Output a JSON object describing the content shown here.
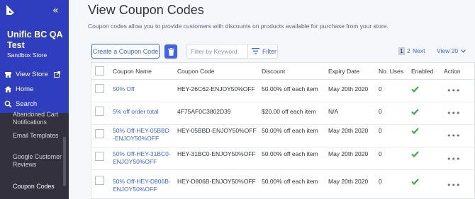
{
  "sidebar": {
    "store_name": "Unific BC QA Test",
    "store_type": "Sandbox Store",
    "collapse_icon": "«",
    "nav": [
      {
        "label": "View Store",
        "icon": "storefront-icon"
      },
      {
        "label": "Home",
        "icon": "home-icon"
      },
      {
        "label": "Search",
        "icon": "search-icon"
      }
    ],
    "items": [
      {
        "label": "Abandoned Cart Notifications"
      },
      {
        "label": "Email Templates"
      },
      {
        "label": "Google Customer Reviews"
      },
      {
        "label": "Coupon Codes"
      }
    ]
  },
  "page": {
    "title": "View Coupon Codes",
    "description": "Coupon codes allow you to provide customers with discounts on products available for purchase from your store."
  },
  "toolbar": {
    "create_label": "Create a Coupon Code",
    "filter_placeholder": "Filter by Keyword",
    "filter_label": "Filter",
    "pagination": {
      "current": "1",
      "page2": "2",
      "next": "Next"
    },
    "view_label": "View 20"
  },
  "table": {
    "headers": [
      "Coupon Name",
      "Coupon Code",
      "Discount",
      "Expiry Date",
      "No. Uses",
      "Enabled",
      "Action"
    ],
    "rows": [
      {
        "name": "50% Off",
        "code": "HEY-26C62-ENJOY50%OFF",
        "discount": "50.00% off each item",
        "expiry": "May 20th 2020",
        "uses": "0"
      },
      {
        "name": "5% off order total",
        "code": "4F75AF0C3802D39",
        "discount": "$20.00 off each item",
        "expiry": "N/A",
        "uses": "0"
      },
      {
        "name": "50% Off-HEY-05BBD-ENJOY50%OFF",
        "code": "HEY-05BBD-ENJOY50%OFF",
        "discount": "50.00% off each item",
        "expiry": "May 20th 2020",
        "uses": "0"
      },
      {
        "name": "50% Off-HEY-31BC0-ENJOY50%OFF",
        "code": "HEY-31BC0-ENJOY50%OFF",
        "discount": "50.00% off each item",
        "expiry": "May 20th 2020",
        "uses": "0"
      },
      {
        "name": "50% Off-HEY-D806B-ENJOY50%OFF",
        "code": "HEY-D806B-ENJOY50%OFF",
        "discount": "50.00% off each item",
        "expiry": "May 20th 2020",
        "uses": "0"
      }
    ],
    "action_label": "•••"
  },
  "colors": {
    "accent": "#3c64f4",
    "sidebar_top": "#2f3dbf",
    "sidebar": "#34313f",
    "enabled": "#3dae46"
  }
}
